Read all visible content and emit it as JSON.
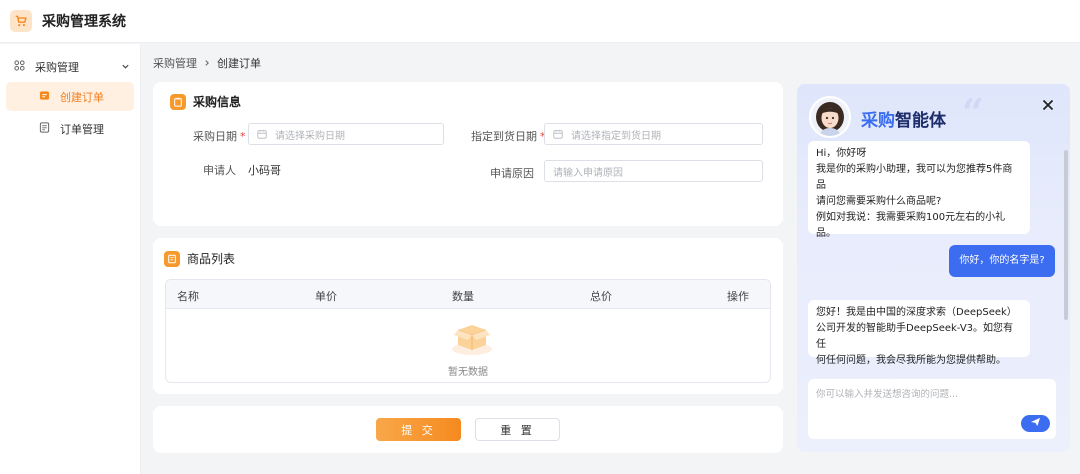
{
  "app": {
    "title": "采购管理系统"
  },
  "sidebar": {
    "group": {
      "label": "采购管理"
    },
    "items": [
      {
        "label": "创建订单",
        "active": true
      },
      {
        "label": "订单管理",
        "active": false
      }
    ]
  },
  "breadcrumb": {
    "parent": "采购管理",
    "current": "创建订单"
  },
  "purchase_info": {
    "title": "采购信息",
    "purchase_date": {
      "label": "采购日期",
      "placeholder": "请选择采购日期"
    },
    "delivery_date": {
      "label": "指定到货日期",
      "placeholder": "请选择指定到货日期"
    },
    "applicant": {
      "label": "申请人",
      "value": "小码哥"
    },
    "reason": {
      "label": "申请原因",
      "placeholder": "请输入申请原因"
    }
  },
  "product_list": {
    "title": "商品列表",
    "columns": [
      "名称",
      "单价",
      "数量",
      "总价",
      "操作"
    ],
    "rows": [],
    "empty_text": "暂无数据"
  },
  "actions": {
    "submit": "提 交",
    "reset": "重 置"
  },
  "chat": {
    "title_part1": "采购",
    "title_part2": "智能体",
    "messages": [
      {
        "role": "assistant",
        "lines": [
          "Hi，你好呀",
          "我是你的采购小助理，我可以为您推荐5件商品",
          "请问您需要采购什么商品呢?",
          "例如对我说：我需要采购100元左右的小礼",
          "品。"
        ]
      },
      {
        "role": "user",
        "lines": [
          "你好，你的名字是?"
        ]
      },
      {
        "role": "assistant",
        "lines": [
          "您好！我是由中国的深度求索（DeepSeek）",
          "公司开发的智能助手DeepSeek-V3。如您有任",
          "何任何问题，我会尽我所能为您提供帮助。"
        ]
      }
    ],
    "input_placeholder": "你可以输入并发送想咨询的问题..."
  },
  "colors": {
    "accent": "#f58a1f",
    "chat_accent": "#3c6cf0"
  }
}
